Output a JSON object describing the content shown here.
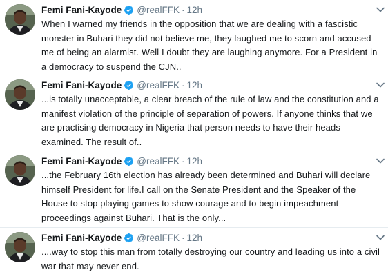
{
  "colors": {
    "text": "#14171a",
    "secondary": "#657786",
    "verified": "#1da1f2",
    "divider": "#e6ecf0"
  },
  "icons": {
    "verified": "verified-badge-icon",
    "caret": "chevron-down-icon",
    "avatar": "profile-photo"
  },
  "tweets": [
    {
      "name": "Femi Fani-Kayode",
      "handle": "@realFFK",
      "separator": "·",
      "time": "12h",
      "text": "When I warned my friends in the opposition that we are dealing with a fascistic monster in Buhari they did not believe me, they laughed me to scorn and accused me of being an alarmist. Well I doubt they are laughing anymore. For a President in a democracy to suspend the CJN.."
    },
    {
      "name": "Femi Fani-Kayode",
      "handle": "@realFFK",
      "separator": "·",
      "time": "12h",
      "text": "...is totally unacceptable, a clear breach of the rule of law and the constitution and a manifest violation of the principle of separation of powers. If anyone thinks that we are practising democracy in Nigeria that person needs to have their heads examined. The result of.."
    },
    {
      "name": "Femi Fani-Kayode",
      "handle": "@realFFK",
      "separator": "·",
      "time": "12h",
      "text": "...the February 16th election has already been determined and Buhari will declare himself President for life.I call on the Senate President and the Speaker of the House to stop playing games to show courage and to begin impeachment proceedings against Buhari. That is the only..."
    },
    {
      "name": "Femi Fani-Kayode",
      "handle": "@realFFK",
      "separator": "·",
      "time": "12h",
      "text": "....way to stop this man from totally destroying our country and leading us into a civil war that may never end."
    }
  ]
}
